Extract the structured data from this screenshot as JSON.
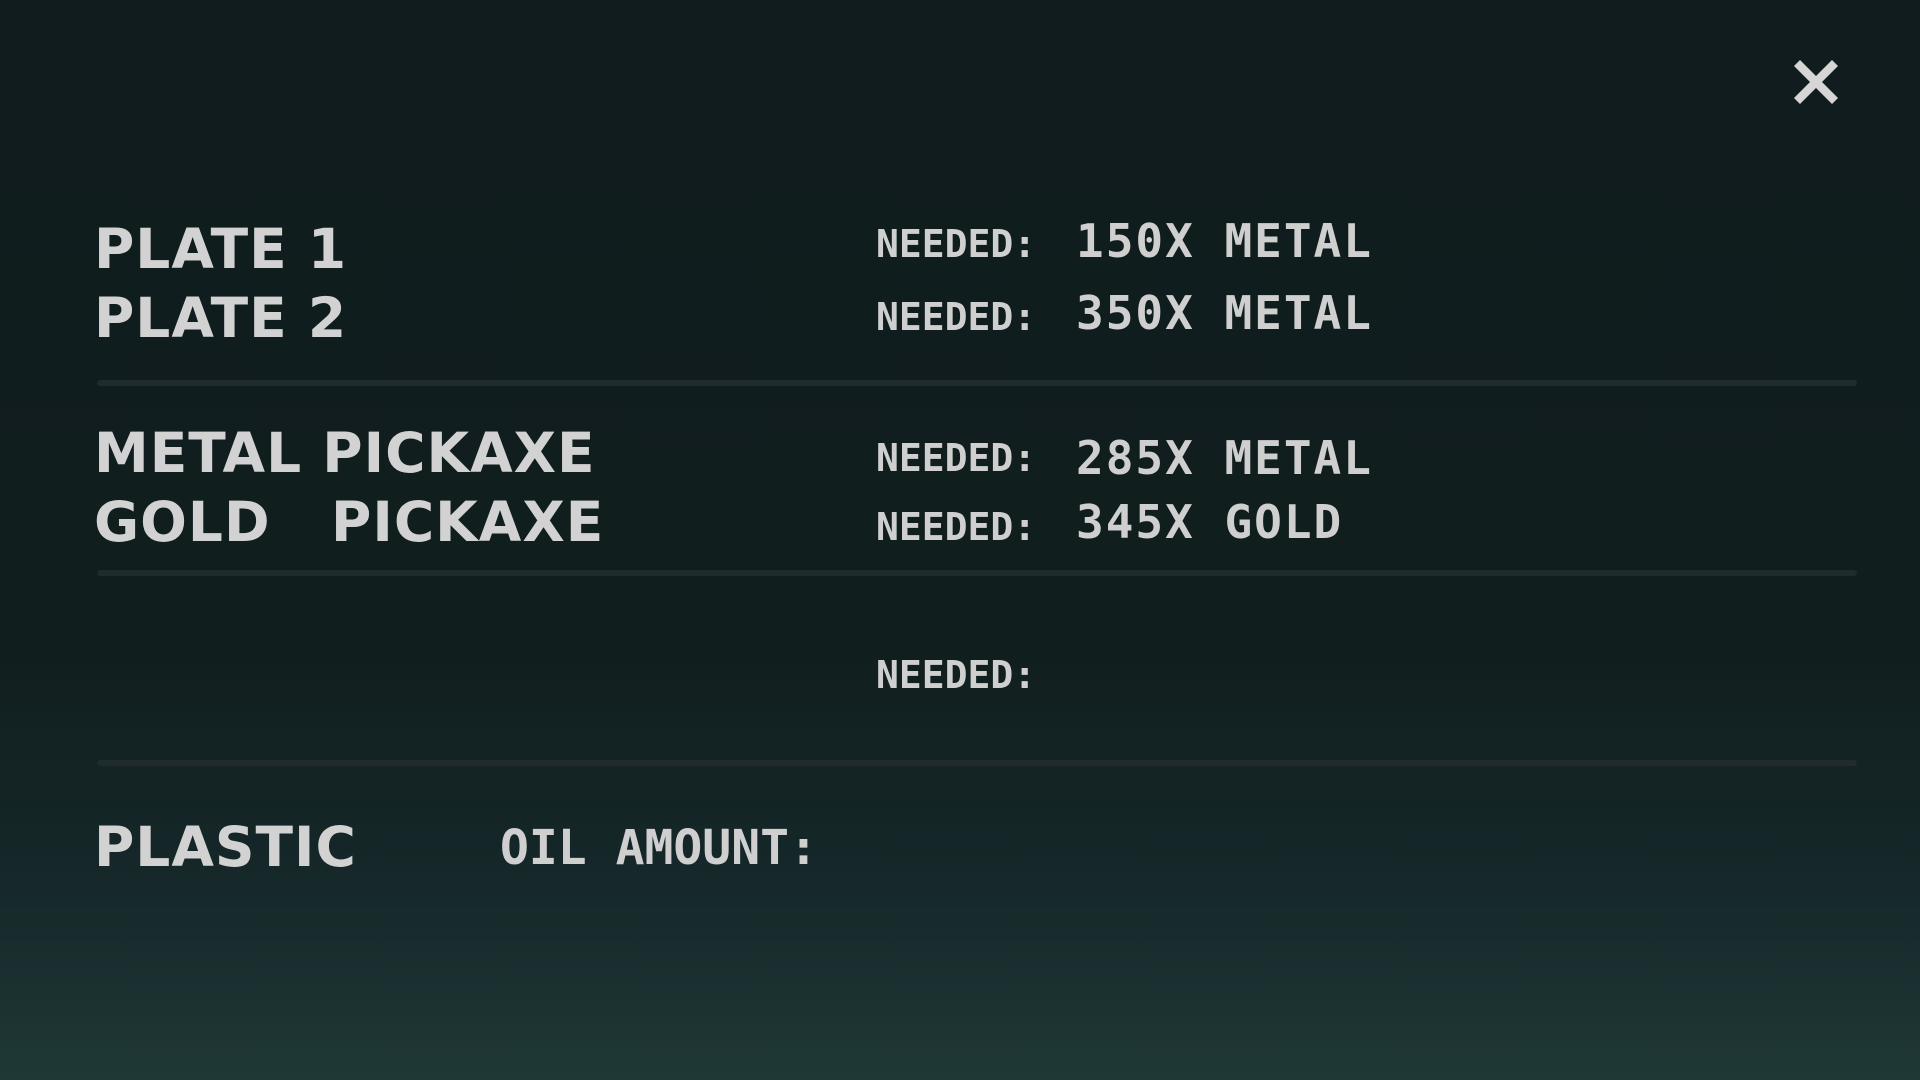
{
  "close_icon": "close-icon",
  "sections": [
    {
      "rows": [
        {
          "name": "Plate 1",
          "needed_label": "Needed:",
          "needed_value": "150x Metal"
        },
        {
          "name": "Plate 2",
          "needed_label": "Needed:",
          "needed_value": "350x Metal"
        }
      ]
    },
    {
      "rows": [
        {
          "name": "Metal Pickaxe",
          "needed_label": "Needed:",
          "needed_value": "285x Metal"
        },
        {
          "name": "Gold   Pickaxe",
          "needed_label": "Needed:",
          "needed_value": "345x Gold"
        }
      ]
    },
    {
      "rows": [
        {
          "name": "",
          "needed_label": "Needed:",
          "needed_value": ""
        }
      ]
    }
  ],
  "plastic": {
    "name": "Plastic",
    "oil_label": "Oil Amount:"
  },
  "colors": {
    "text": "#cfcfcf",
    "background_top": "#101c1d",
    "background_bottom": "#1f3836",
    "divider": "#1f2b2c"
  }
}
